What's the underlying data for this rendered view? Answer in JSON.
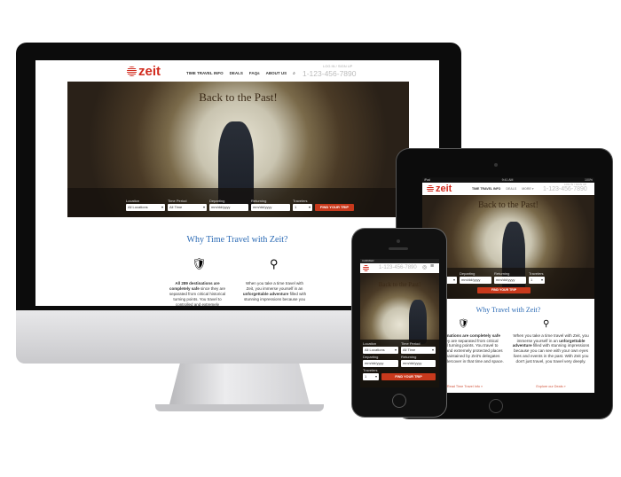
{
  "brand": {
    "name": "zeit",
    "accent": "#c8391c",
    "heading_color": "#2c6bb5"
  },
  "desktop": {
    "nav": [
      "TIME TRAVEL INFO",
      "DEALS",
      "FAQs",
      "ABOUT US"
    ],
    "login": "LOG IN / SIGN UP",
    "phone": "1-123-456-7890",
    "hero_title": "Back to the Past!",
    "search": {
      "location_label": "Location",
      "location": "All Locations",
      "period_label": "Time Period",
      "period": "All Time",
      "departing_label": "Departing",
      "departing": "mm/dd/yyyy",
      "returning_label": "Returning",
      "returning": "mm/dd/yyyy",
      "travelers_label": "Travelers",
      "travelers": "1",
      "button": "FIND YOUR TRIP"
    },
    "why_title": "Why Time Travel with Zeit?",
    "col1_bold": "All 289 destinations are completely safe",
    "col1_text": "since they are separated from critical historical turning points. You travel to controlled and extremely",
    "col2_text": "When you take a time travel with Zeit, you immerse yourself in an",
    "col2_bold": "unforgettable adventure",
    "col2_text2": "filled with stunning impressions because you"
  },
  "tablet": {
    "status_left": "iPad",
    "status_time": "9:41 AM",
    "status_right": "100%",
    "nav": [
      "TIME TRAVEL INFO",
      "DEALS",
      "MORE ▾"
    ],
    "login": "LOG IN / SIGN UP",
    "phone": "1-123-456-7890",
    "hero_title": "Back to the Past!",
    "search": {
      "period_label": "Time Period",
      "period": "All Time",
      "departing_label": "Departing",
      "departing": "mm/dd/yyyy",
      "returning_label": "Returning",
      "returning": "mm/dd/yyyy",
      "travelers_label": "Travelers",
      "travelers": "1",
      "button": "FIND YOUR TRIP"
    },
    "why_title": "Why Travel with Zeit?",
    "col1_bold": "289 destinations are completely safe",
    "col1_text": "since they are separated from critical historical turning points. You travel to controlled and extremely protected places and are maintained by Zeit's delegates working undercover in that time and space.",
    "col2_text": "When you take a time travel with Zeit, you immerse yourself in an",
    "col2_bold": "unforgettable adventure",
    "col2_text2": "filled with stunning impressions because you can see with your own eyes lives and events in the past. With Zeit you don't just travel, you travel very deeply.",
    "link1": "Read Time Travel Info »",
    "link2": "Explore our Deals »"
  },
  "phone": {
    "carrier": "CARRIER",
    "phone": "1-123-456-7890",
    "hero_title": "Back to the Past!",
    "search": {
      "location_label": "Location",
      "location": "All Locations",
      "period_label": "Time Period",
      "period": "All Time",
      "departing_label": "Departing",
      "departing": "mm/dd/yyyy",
      "returning_label": "Returning",
      "returning": "mm/dd/yyyy",
      "travelers_label": "Travelers",
      "travelers": "1",
      "button": "FIND YOUR TRIP"
    }
  }
}
